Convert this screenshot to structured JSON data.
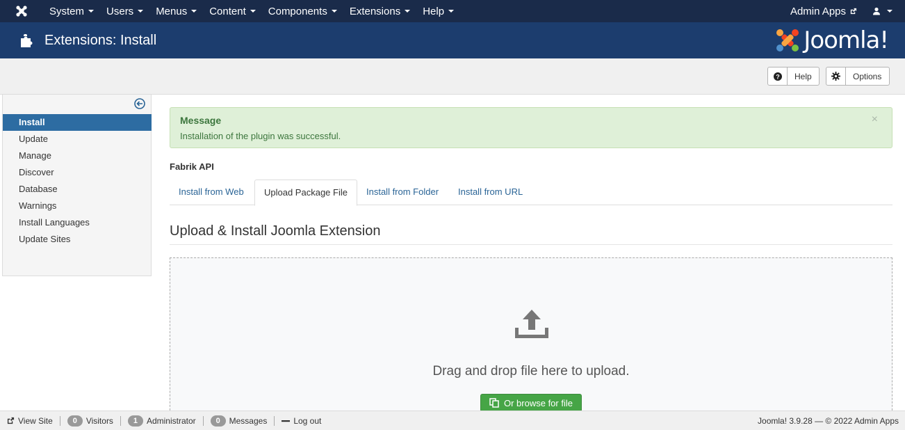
{
  "topbar": {
    "menu": [
      {
        "label": "System"
      },
      {
        "label": "Users"
      },
      {
        "label": "Menus"
      },
      {
        "label": "Content"
      },
      {
        "label": "Components"
      },
      {
        "label": "Extensions"
      },
      {
        "label": "Help"
      }
    ],
    "admin_apps": "Admin Apps"
  },
  "header": {
    "title": "Extensions: Install",
    "logo_text": "Joomla!"
  },
  "toolbar": {
    "help_label": "Help",
    "options_label": "Options"
  },
  "sidebar": {
    "items": [
      {
        "label": "Install",
        "active": true
      },
      {
        "label": "Update"
      },
      {
        "label": "Manage"
      },
      {
        "label": "Discover"
      },
      {
        "label": "Database"
      },
      {
        "label": "Warnings"
      },
      {
        "label": "Install Languages"
      },
      {
        "label": "Update Sites"
      }
    ]
  },
  "alert": {
    "heading": "Message",
    "text": "Installation of the plugin was successful.",
    "close": "×"
  },
  "fabrik_label": "Fabrik API",
  "tabs": [
    {
      "label": "Install from Web"
    },
    {
      "label": "Upload Package File",
      "active": true
    },
    {
      "label": "Install from Folder"
    },
    {
      "label": "Install from URL"
    }
  ],
  "section_title": "Upload & Install Joomla Extension",
  "dropzone": {
    "text": "Drag and drop file here to upload.",
    "browse_label": "Or browse for file"
  },
  "footer": {
    "view_site": "View Site",
    "visitors_count": "0",
    "visitors_label": "Visitors",
    "admin_count": "1",
    "admin_label": "Administrator",
    "messages_count": "0",
    "messages_label": "Messages",
    "logout": "Log out",
    "copyright": "Joomla! 3.9.28 — © 2022 Admin Apps"
  },
  "colors": {
    "topbar_bg": "#1a2b4a",
    "header_bg": "#1c3d6e",
    "sidebar_active": "#2d6ca2",
    "success_bg": "#dff0d8",
    "browse_button": "#46a546"
  }
}
